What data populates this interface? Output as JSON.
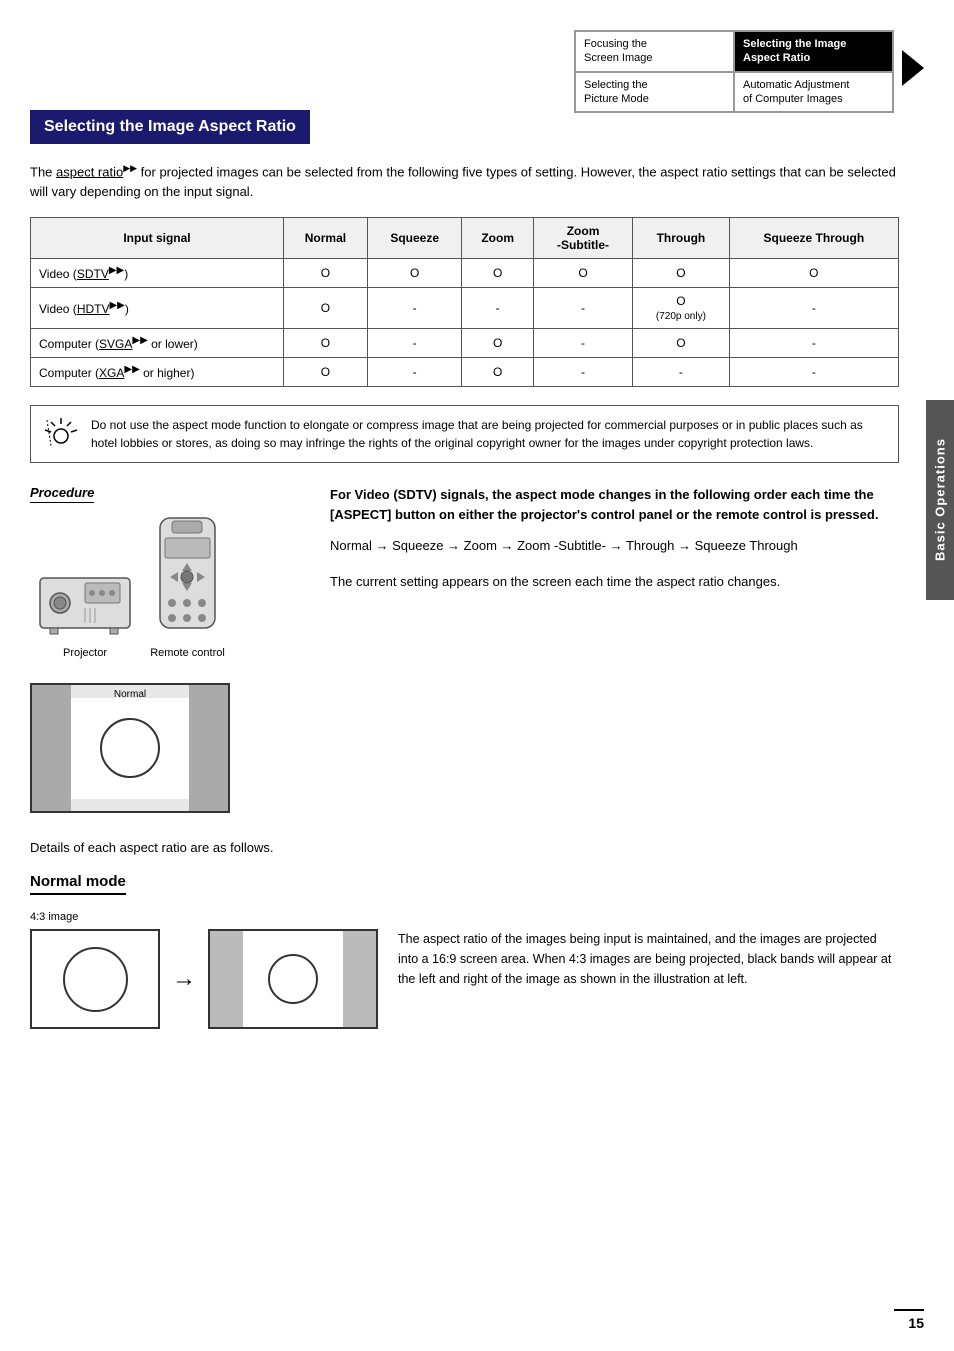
{
  "nav": {
    "cell1": {
      "label": "Focusing the\nScreen Image",
      "active": false
    },
    "cell2": {
      "label": "Selecting the Image\nAspect Ratio",
      "active": true
    },
    "cell3": {
      "label": "Selecting the\nPicture Mode",
      "active": false
    },
    "cell4": {
      "label": "Automatic Adjustment\nof Computer Images",
      "active": false
    }
  },
  "title": "Selecting the Image Aspect Ratio",
  "intro": {
    "text": "The aspect ratio▶▶ for projected images can be selected from the following five types of setting. However, the aspect ratio settings that can be selected will vary depending on the input signal."
  },
  "table": {
    "headers": [
      "Input signal",
      "Normal",
      "Squeeze",
      "Zoom",
      "Zoom\n-Subtitle-",
      "Through",
      "Squeeze Through"
    ],
    "rows": [
      [
        "Video (SDTV▶▶)",
        "O",
        "O",
        "O",
        "O",
        "O",
        "O"
      ],
      [
        "Video (HDTV▶▶)",
        "O",
        "-",
        "-",
        "-",
        "O\n(720p only)",
        "-"
      ],
      [
        "Computer (SVGA▶▶ or lower)",
        "O",
        "-",
        "O",
        "-",
        "O",
        "-"
      ],
      [
        "Computer (XGA▶▶ or higher)",
        "O",
        "-",
        "O",
        "-",
        "-",
        "-"
      ]
    ]
  },
  "warning": {
    "text": "Do not use the aspect mode function to elongate or compress image that are being projected for commercial purposes or in public places such as hotel lobbies or stores, as doing so may infringe the rights of the original copyright owner for the images under copyright protection laws."
  },
  "procedure": {
    "label": "Procedure",
    "projector_label": "Projector",
    "remote_label": "Remote control",
    "screen_label": "Normal",
    "bold_text": "For Video (SDTV) signals, the aspect mode changes in the following order each time the [ASPECT] button on either the projector's control panel or the remote control is pressed.",
    "sequence_text": "Normal → Squeeze → Zoom → Zoom -Subtitle- → Through → Squeeze Through",
    "current_setting_text": "The current setting appears on the screen each time the aspect ratio changes."
  },
  "details": {
    "text": "Details of each aspect ratio are as follows."
  },
  "normal_mode": {
    "title": "Normal mode",
    "image_label": "4:3 image",
    "description": "The aspect ratio of the images being input is maintained, and the images are projected into a 16:9 screen area. When 4:3 images are being projected, black bands will appear at the left and right of the image as shown in the illustration at left."
  },
  "side_tab": {
    "label": "Basic Operations"
  },
  "page_number": "15"
}
